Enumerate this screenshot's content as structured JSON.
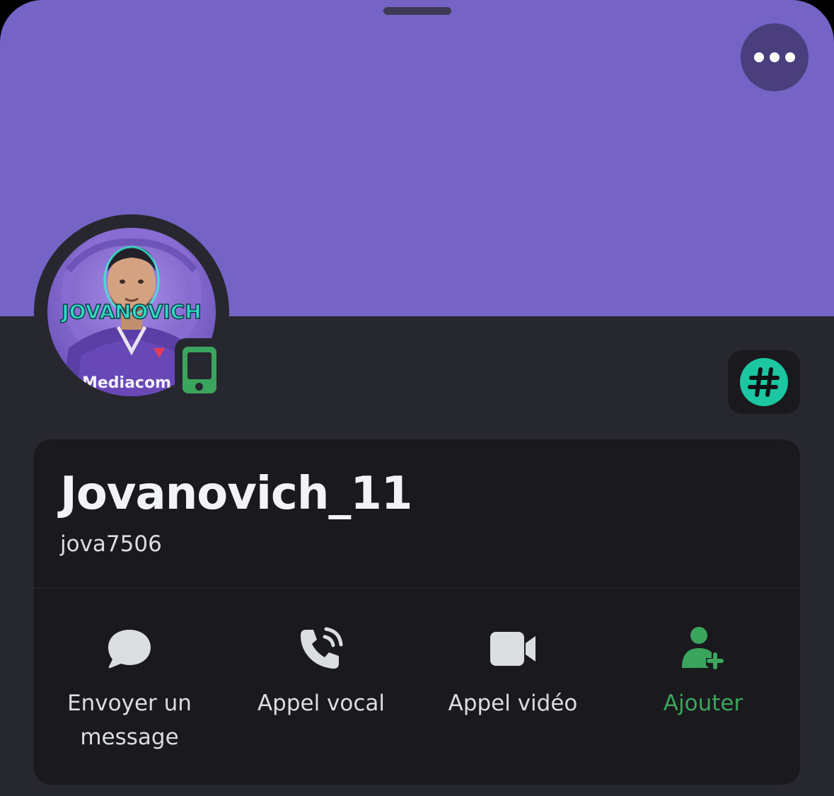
{
  "profile": {
    "display_name": "Jovanovich_11",
    "username": "jova7506",
    "status": "mobile-online",
    "banner_color": "#7563c6",
    "avatar_text": "JOVANOVICH",
    "avatar_sponsor": "Mediacom"
  },
  "header": {
    "more_icon": "more-horizontal-icon"
  },
  "badge": {
    "icon": "hashtag-icon",
    "color": "#1bc6a1"
  },
  "actions": [
    {
      "label": "Envoyer un message",
      "icon": "message-bubble-icon"
    },
    {
      "label": "Appel vocal",
      "icon": "phone-call-icon"
    },
    {
      "label": "Appel vidéo",
      "icon": "video-camera-icon"
    },
    {
      "label": "Ajouter",
      "icon": "add-friend-icon",
      "color": "#3ba55d"
    }
  ]
}
